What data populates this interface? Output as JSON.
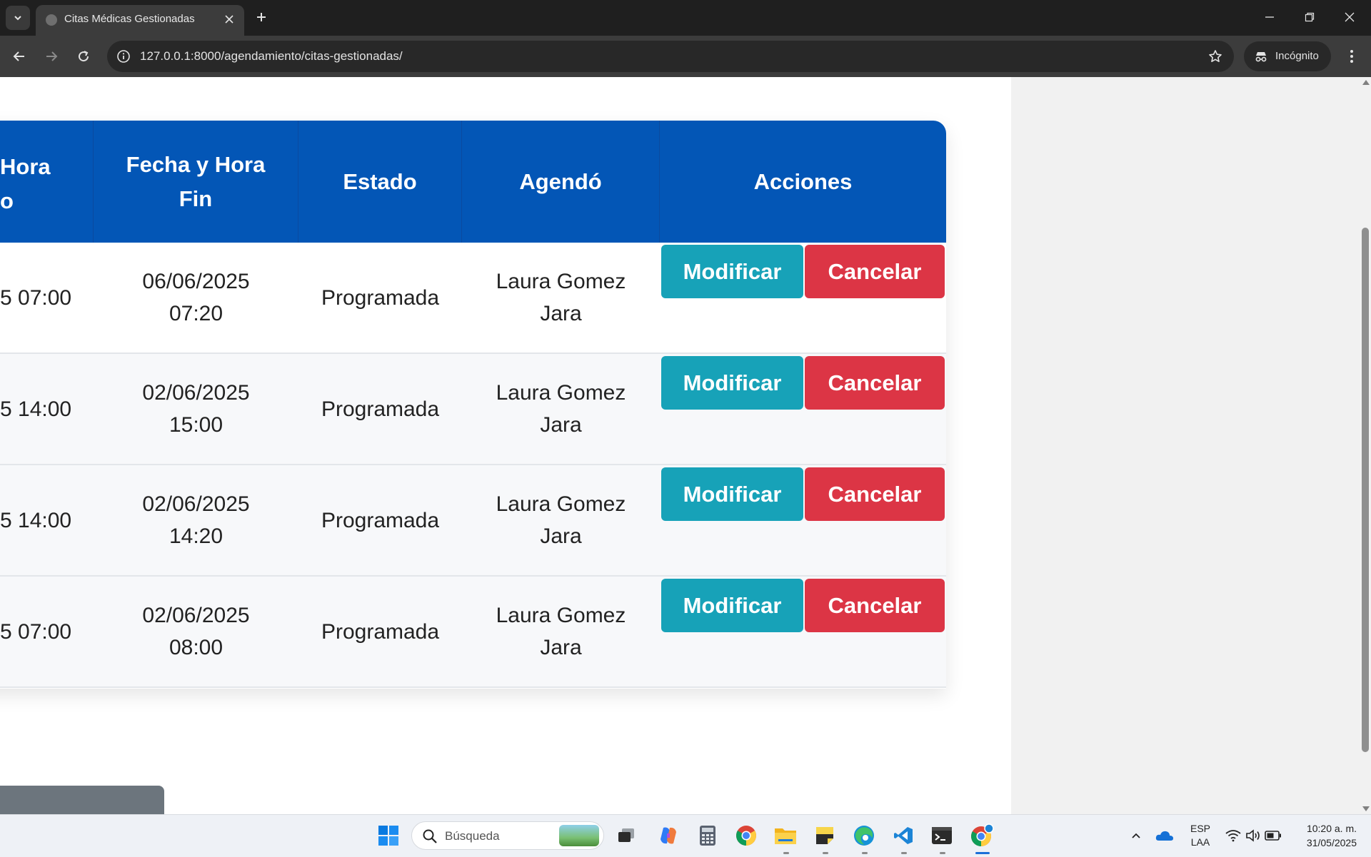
{
  "browser": {
    "tab_title": "Citas Médicas Gestionadas",
    "url": "127.0.0.1:8000/agendamiento/citas-gestionadas/",
    "incognito_label": "Incógnito"
  },
  "table": {
    "headers": {
      "start": "Hora\no",
      "end": "Fecha y Hora\nFin",
      "status": "Estado",
      "scheduled_by": "Agendó",
      "actions": "Acciones"
    },
    "rows": [
      {
        "start": "5 07:00",
        "end": "06/06/2025\n07:20",
        "status": "Programada",
        "scheduled_by": "Laura Gomez\nJara",
        "modify_label": "Modificar",
        "cancel_label": "Cancelar"
      },
      {
        "start": "5 14:00",
        "end": "02/06/2025\n15:00",
        "status": "Programada",
        "scheduled_by": "Laura Gomez\nJara",
        "modify_label": "Modificar",
        "cancel_label": "Cancelar"
      },
      {
        "start": "5 14:00",
        "end": "02/06/2025\n14:20",
        "status": "Programada",
        "scheduled_by": "Laura Gomez\nJara",
        "modify_label": "Modificar",
        "cancel_label": "Cancelar"
      },
      {
        "start": "5 07:00",
        "end": "02/06/2025\n08:00",
        "status": "Programada",
        "scheduled_by": "Laura Gomez\nJara",
        "modify_label": "Modificar",
        "cancel_label": "Cancelar"
      }
    ]
  },
  "colors": {
    "header_blue": "#0356b6",
    "modify": "#17a2b8",
    "cancel": "#dc3545",
    "back_button": "#6c757d"
  },
  "taskbar": {
    "search_placeholder": "Búsqueda",
    "language_line1": "ESP",
    "language_line2": "LAA",
    "time": "10:20 a. m.",
    "date": "31/05/2025",
    "icons": [
      "windows-start-icon",
      "task-view-icon",
      "copilot-icon",
      "calculator-icon",
      "chrome-icon",
      "file-explorer-icon",
      "sticky-notes-icon",
      "edge-icon",
      "vscode-icon",
      "terminal-icon",
      "chrome-canary-icon"
    ]
  }
}
